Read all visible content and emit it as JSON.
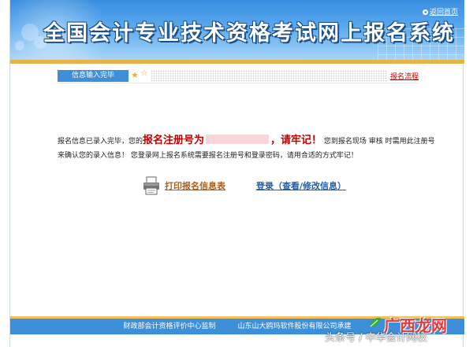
{
  "banner": {
    "title": "全国会计专业技术资格考试网上报名系统",
    "return_link": "返回首页"
  },
  "steps": {
    "current_label": "信息输入完毕",
    "process_link": "报名流程"
  },
  "message": {
    "part1": "报名信息已录入完毕，您的",
    "reg_label": "报名注册号为",
    "reg_suffix": "，请牢记！",
    "part2": "您到报名现场 审核 时需用此注册号来确认您的录入信息！ 您登录网上报名系统需要报名注册号和登录密码，请用合适的方式牢记！"
  },
  "actions": {
    "print_label": "打印报名信息表",
    "login_label": "登录（查看/修改信息）"
  },
  "footer": {
    "left": "财政部会计资格评价中心监制",
    "right": "山东山大鸥玛软件股份有限公司承建"
  },
  "watermark": {
    "brand": "广西龙网",
    "caption": "头条号 / 中华会计网校"
  },
  "colors": {
    "banner_blue": "#3a8fe0",
    "footer_blue": "#3c8fd8",
    "accent_red": "#c00000",
    "gold": "#e8b24a"
  }
}
